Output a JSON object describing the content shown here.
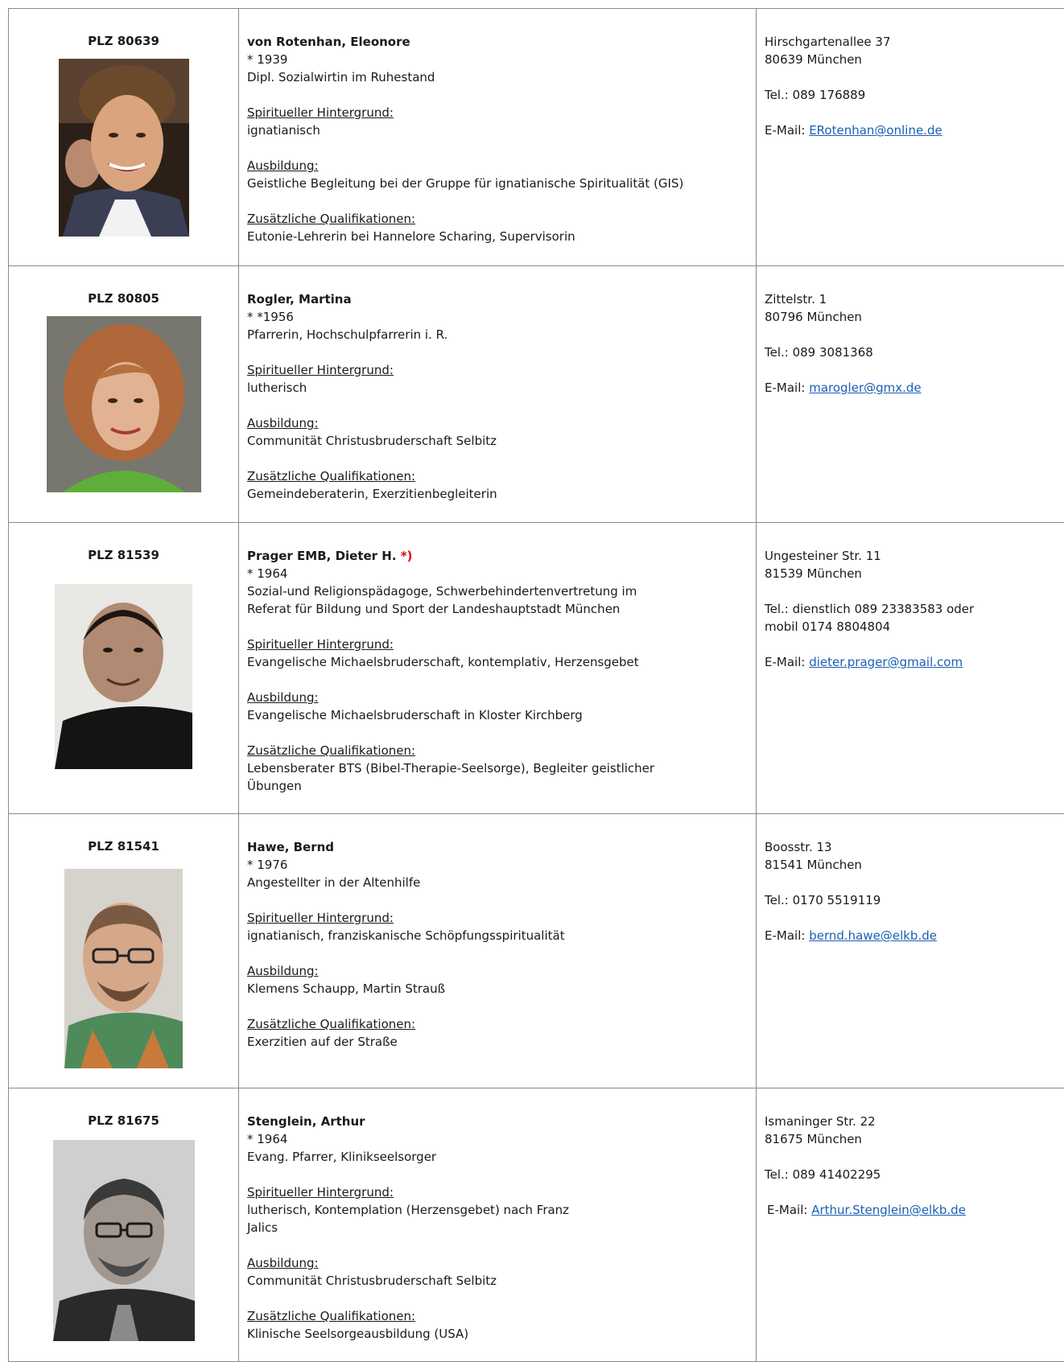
{
  "entries": [
    {
      "plz": "PLZ 80639",
      "name": "von Rotenhan, Eleonore",
      "born": "* 1939",
      "profession": "Dipl. Sozialwirtin im Ruhestand",
      "spiritual_label": "Spiritueller Hintergrund:",
      "spiritual": "ignatianisch",
      "training_label": "Ausbildung:",
      "training": "Geistliche Begleitung bei der Gruppe für ignatianische Spiritualität (GIS)",
      "qual_label": "Zusätzliche Qualifikationen:",
      "qual": "Eutonie-Lehrerin bei Hannelore Scharing, Supervisorin",
      "street": "Hirschgartenallee 37",
      "city": "80639 München",
      "phone": "Tel.: 089 176889",
      "email_prefix": "E-Mail:",
      "email": "ERotenhan@online.de"
    },
    {
      "plz": "PLZ 80805",
      "name": "Rogler, Martina",
      "born": "* *1956",
      "profession": "Pfarrerin, Hochschulpfarrerin i. R.",
      "spiritual_label": "Spiritueller Hintergrund:",
      "spiritual": "lutherisch",
      "training_label": "Ausbildung:",
      "training": "Communität Christusbruderschaft Selbitz",
      "qual_label": "Zusätzliche Qualifikationen:",
      "qual": "Gemeindeberaterin, Exerzitienbegleiterin",
      "street": "Zittelstr. 1",
      "city": "80796 München",
      "phone": "Tel.: 089 3081368",
      "email_prefix": "E-Mail:",
      "email": "marogler@gmx.de"
    },
    {
      "plz": "PLZ 81539",
      "name": "Prager EMB, Dieter H.",
      "name_mark": "*)",
      "born": "* 1964",
      "profession_1": "Sozial-und Religionspädagoge, Schwerbehindertenvertretung im",
      "profession_2": "Referat für Bildung und Sport der Landeshauptstadt München",
      "spiritual_label": "Spiritueller Hintergrund:",
      "spiritual": "Evangelische Michaelsbruderschaft, kontemplativ, Herzensgebet",
      "training_label": "Ausbildung:",
      "training": "Evangelische Michaelsbruderschaft in Kloster Kirchberg",
      "qual_label": "Zusätzliche Qualifikationen:",
      "qual_1": "Lebensberater BTS (Bibel-Therapie-Seelsorge), Begleiter geistlicher",
      "qual_2": "Übungen",
      "street": "Ungesteiner Str. 11",
      "city": "81539 München",
      "phone_1": "Tel.: dienstlich 089 23383583 oder",
      "phone_2": "mobil 0174 8804804",
      "email_prefix": "E-Mail:",
      "email": "dieter.prager@gmail.com"
    },
    {
      "plz": "PLZ 81541",
      "name": "Hawe, Bernd",
      "born": "* 1976",
      "profession": "Angestellter in der Altenhilfe",
      "spiritual_label": "Spiritueller Hintergrund:",
      "spiritual": "ignatianisch, franziskanische Schöpfungsspiritualität",
      "training_label": "Ausbildung:",
      "training": "Klemens Schaupp, Martin Strauß",
      "qual_label": "Zusätzliche Qualifikationen:",
      "qual": "Exerzitien auf der Straße",
      "street": "Boosstr. 13",
      "city": "81541 München",
      "phone": "Tel.: 0170 5519119",
      "email_prefix": "E-Mail:",
      "email": "bernd.hawe@elkb.de"
    },
    {
      "plz": "PLZ 81675",
      "name": "Stenglein, Arthur",
      "born": "* 1964",
      "profession": "Evang. Pfarrer, Klinikseelsorger",
      "spiritual_label": "Spiritueller Hintergrund:",
      "spiritual_1": "lutherisch, Kontemplation (Herzensgebet) nach Franz",
      "spiritual_2": "Jalics",
      "training_label": "Ausbildung:",
      "training": "Communität Christusbruderschaft Selbitz",
      "qual_label": "Zusätzliche Qualifikationen:",
      "qual": "Klinische Seelsorgeausbildung (USA)",
      "street": "Ismaninger Str. 22",
      "city": "81675 München",
      "phone": "Tel.: 089 41402295",
      "email_prefix": "E-Mail:",
      "email": "Arthur.Stenglein@elkb.de"
    }
  ]
}
